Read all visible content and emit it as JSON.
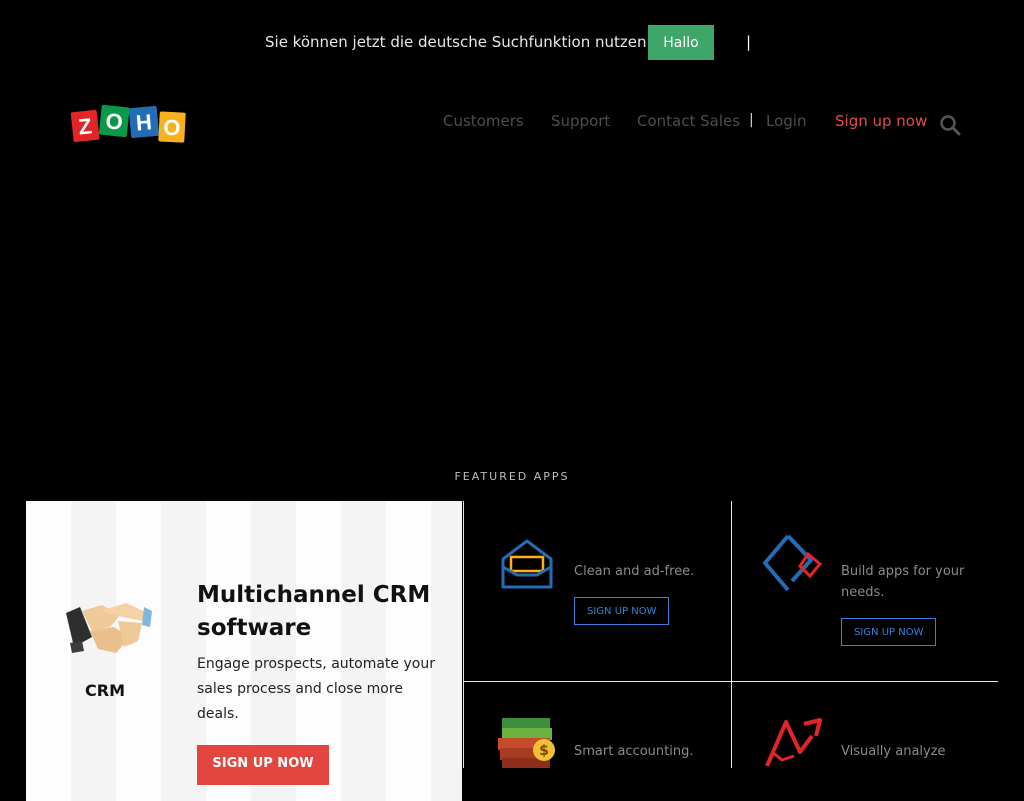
{
  "language_banner": {
    "message": "Sie können jetzt die deutsche Suchfunktion nutzen!",
    "button_label": "Hallo",
    "close_glyph": "|"
  },
  "header": {
    "logo_text": "ZOHO",
    "nav": {
      "customers": "Customers",
      "support": "Support",
      "contact_sales": "Contact Sales",
      "separator": "|",
      "login": "Login",
      "signup": "Sign up now"
    },
    "icons": {
      "search": "search-icon"
    }
  },
  "featured": {
    "label": "FEATURED APPS",
    "crm": {
      "name": "CRM",
      "title": "Multichannel CRM software",
      "description": "Engage prospects, automate your sales process and close more deals.",
      "button": "SIGN UP NOW",
      "icon": "handshake-icon"
    },
    "apps": [
      {
        "icon": "mail-icon",
        "description": "Clean and ad-free.",
        "button": "SIGN UP NOW"
      },
      {
        "icon": "creator-icon",
        "description": "Build apps for your needs.",
        "button": "SIGN UP NOW"
      },
      {
        "icon": "books-icon",
        "description": "Smart accounting."
      },
      {
        "icon": "analytics-icon",
        "description": "Visually analyze"
      }
    ]
  },
  "colors": {
    "background": "#000000",
    "primary_green": "#3fa66a",
    "signup_red": "#e24b4b",
    "accent_blue": "#3b82d6",
    "crm_button": "#e2463f"
  }
}
